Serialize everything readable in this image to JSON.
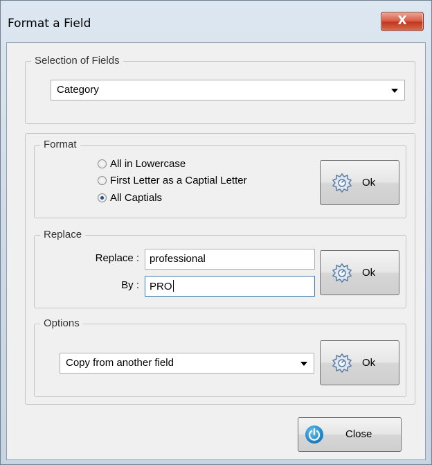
{
  "window": {
    "title": "Format a Field",
    "close_glyph": "X"
  },
  "selection": {
    "legend": "Selection of Fields",
    "field_value": "Category"
  },
  "format": {
    "legend": "Format",
    "options": [
      "All in Lowercase",
      "First Letter as a Captial Letter",
      "All Captials"
    ],
    "selected_index": 2,
    "ok_label": "Ok"
  },
  "replace": {
    "legend": "Replace",
    "replace_label": "Replace :",
    "replace_value": "professional",
    "by_label": "By :",
    "by_value": "PRO",
    "ok_label": "Ok"
  },
  "options": {
    "legend": "Options",
    "value": "Copy from another field",
    "ok_label": "Ok"
  },
  "footer": {
    "close_label": "Close"
  },
  "icons": {
    "ok": "gear-icon",
    "close": "power-icon"
  },
  "colors": {
    "accent": "#1f86c8",
    "close_button": "#c2381f"
  }
}
